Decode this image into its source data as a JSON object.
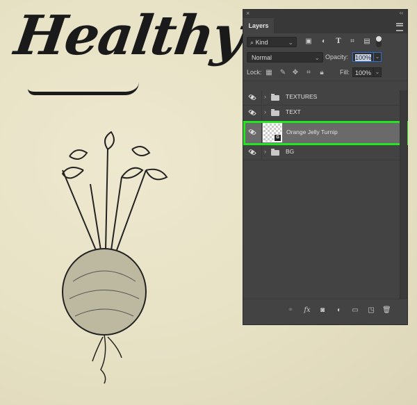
{
  "canvas": {
    "headline": "Healthy",
    "illustration": "turnip-engraving",
    "background_color": "#e9e4c9"
  },
  "panel": {
    "close_label": "×",
    "collapse_label": "‹‹",
    "tab_label": "Layers",
    "filter": {
      "kind_label": "Kind",
      "icons": [
        "pixel-filter-icon",
        "adjustment-filter-icon",
        "type-filter-icon",
        "shape-filter-icon",
        "smart-object-filter-icon"
      ]
    },
    "blend_mode": "Normal",
    "opacity_label": "Opacity:",
    "opacity_value": "100%",
    "lock_label": "Lock:",
    "fill_label": "Fill:",
    "fill_value": "100%",
    "layers": [
      {
        "name": "TEXTURES",
        "type": "group",
        "visible": true,
        "selected": false
      },
      {
        "name": "TEXT",
        "type": "group",
        "visible": true,
        "selected": false
      },
      {
        "name": "Orange Jelly Turnip",
        "type": "smart-object",
        "visible": true,
        "selected": true
      },
      {
        "name": "BG",
        "type": "group",
        "visible": true,
        "selected": false
      }
    ],
    "highlight_color": "#22e61f"
  }
}
